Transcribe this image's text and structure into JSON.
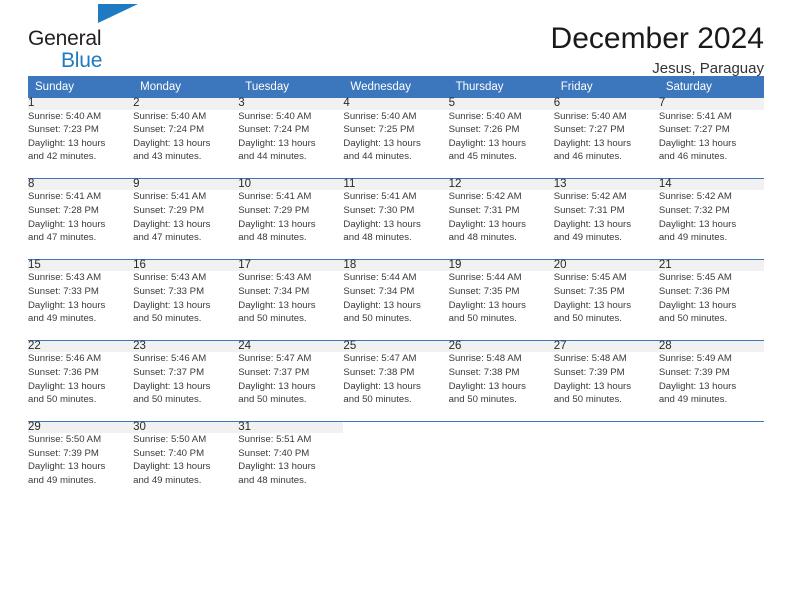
{
  "brand": {
    "name_top": "General",
    "name_bottom": "Blue",
    "flag_icon": "blue-flag-icon",
    "accent_color": "#1f7bc1"
  },
  "header": {
    "title": "December 2024",
    "subtitle": "Jesus, Paraguay"
  },
  "calendar": {
    "header_bg": "#3c77bd",
    "daynum_bg": "#f1f1f1",
    "weekday_headers": [
      "Sunday",
      "Monday",
      "Tuesday",
      "Wednesday",
      "Thursday",
      "Friday",
      "Saturday"
    ],
    "weeks": [
      [
        {
          "day": "1",
          "sunrise": "Sunrise: 5:40 AM",
          "sunset": "Sunset: 7:23 PM",
          "daylight1": "Daylight: 13 hours",
          "daylight2": "and 42 minutes."
        },
        {
          "day": "2",
          "sunrise": "Sunrise: 5:40 AM",
          "sunset": "Sunset: 7:24 PM",
          "daylight1": "Daylight: 13 hours",
          "daylight2": "and 43 minutes."
        },
        {
          "day": "3",
          "sunrise": "Sunrise: 5:40 AM",
          "sunset": "Sunset: 7:24 PM",
          "daylight1": "Daylight: 13 hours",
          "daylight2": "and 44 minutes."
        },
        {
          "day": "4",
          "sunrise": "Sunrise: 5:40 AM",
          "sunset": "Sunset: 7:25 PM",
          "daylight1": "Daylight: 13 hours",
          "daylight2": "and 44 minutes."
        },
        {
          "day": "5",
          "sunrise": "Sunrise: 5:40 AM",
          "sunset": "Sunset: 7:26 PM",
          "daylight1": "Daylight: 13 hours",
          "daylight2": "and 45 minutes."
        },
        {
          "day": "6",
          "sunrise": "Sunrise: 5:40 AM",
          "sunset": "Sunset: 7:27 PM",
          "daylight1": "Daylight: 13 hours",
          "daylight2": "and 46 minutes."
        },
        {
          "day": "7",
          "sunrise": "Sunrise: 5:41 AM",
          "sunset": "Sunset: 7:27 PM",
          "daylight1": "Daylight: 13 hours",
          "daylight2": "and 46 minutes."
        }
      ],
      [
        {
          "day": "8",
          "sunrise": "Sunrise: 5:41 AM",
          "sunset": "Sunset: 7:28 PM",
          "daylight1": "Daylight: 13 hours",
          "daylight2": "and 47 minutes."
        },
        {
          "day": "9",
          "sunrise": "Sunrise: 5:41 AM",
          "sunset": "Sunset: 7:29 PM",
          "daylight1": "Daylight: 13 hours",
          "daylight2": "and 47 minutes."
        },
        {
          "day": "10",
          "sunrise": "Sunrise: 5:41 AM",
          "sunset": "Sunset: 7:29 PM",
          "daylight1": "Daylight: 13 hours",
          "daylight2": "and 48 minutes."
        },
        {
          "day": "11",
          "sunrise": "Sunrise: 5:41 AM",
          "sunset": "Sunset: 7:30 PM",
          "daylight1": "Daylight: 13 hours",
          "daylight2": "and 48 minutes."
        },
        {
          "day": "12",
          "sunrise": "Sunrise: 5:42 AM",
          "sunset": "Sunset: 7:31 PM",
          "daylight1": "Daylight: 13 hours",
          "daylight2": "and 48 minutes."
        },
        {
          "day": "13",
          "sunrise": "Sunrise: 5:42 AM",
          "sunset": "Sunset: 7:31 PM",
          "daylight1": "Daylight: 13 hours",
          "daylight2": "and 49 minutes."
        },
        {
          "day": "14",
          "sunrise": "Sunrise: 5:42 AM",
          "sunset": "Sunset: 7:32 PM",
          "daylight1": "Daylight: 13 hours",
          "daylight2": "and 49 minutes."
        }
      ],
      [
        {
          "day": "15",
          "sunrise": "Sunrise: 5:43 AM",
          "sunset": "Sunset: 7:33 PM",
          "daylight1": "Daylight: 13 hours",
          "daylight2": "and 49 minutes."
        },
        {
          "day": "16",
          "sunrise": "Sunrise: 5:43 AM",
          "sunset": "Sunset: 7:33 PM",
          "daylight1": "Daylight: 13 hours",
          "daylight2": "and 50 minutes."
        },
        {
          "day": "17",
          "sunrise": "Sunrise: 5:43 AM",
          "sunset": "Sunset: 7:34 PM",
          "daylight1": "Daylight: 13 hours",
          "daylight2": "and 50 minutes."
        },
        {
          "day": "18",
          "sunrise": "Sunrise: 5:44 AM",
          "sunset": "Sunset: 7:34 PM",
          "daylight1": "Daylight: 13 hours",
          "daylight2": "and 50 minutes."
        },
        {
          "day": "19",
          "sunrise": "Sunrise: 5:44 AM",
          "sunset": "Sunset: 7:35 PM",
          "daylight1": "Daylight: 13 hours",
          "daylight2": "and 50 minutes."
        },
        {
          "day": "20",
          "sunrise": "Sunrise: 5:45 AM",
          "sunset": "Sunset: 7:35 PM",
          "daylight1": "Daylight: 13 hours",
          "daylight2": "and 50 minutes."
        },
        {
          "day": "21",
          "sunrise": "Sunrise: 5:45 AM",
          "sunset": "Sunset: 7:36 PM",
          "daylight1": "Daylight: 13 hours",
          "daylight2": "and 50 minutes."
        }
      ],
      [
        {
          "day": "22",
          "sunrise": "Sunrise: 5:46 AM",
          "sunset": "Sunset: 7:36 PM",
          "daylight1": "Daylight: 13 hours",
          "daylight2": "and 50 minutes."
        },
        {
          "day": "23",
          "sunrise": "Sunrise: 5:46 AM",
          "sunset": "Sunset: 7:37 PM",
          "daylight1": "Daylight: 13 hours",
          "daylight2": "and 50 minutes."
        },
        {
          "day": "24",
          "sunrise": "Sunrise: 5:47 AM",
          "sunset": "Sunset: 7:37 PM",
          "daylight1": "Daylight: 13 hours",
          "daylight2": "and 50 minutes."
        },
        {
          "day": "25",
          "sunrise": "Sunrise: 5:47 AM",
          "sunset": "Sunset: 7:38 PM",
          "daylight1": "Daylight: 13 hours",
          "daylight2": "and 50 minutes."
        },
        {
          "day": "26",
          "sunrise": "Sunrise: 5:48 AM",
          "sunset": "Sunset: 7:38 PM",
          "daylight1": "Daylight: 13 hours",
          "daylight2": "and 50 minutes."
        },
        {
          "day": "27",
          "sunrise": "Sunrise: 5:48 AM",
          "sunset": "Sunset: 7:39 PM",
          "daylight1": "Daylight: 13 hours",
          "daylight2": "and 50 minutes."
        },
        {
          "day": "28",
          "sunrise": "Sunrise: 5:49 AM",
          "sunset": "Sunset: 7:39 PM",
          "daylight1": "Daylight: 13 hours",
          "daylight2": "and 49 minutes."
        }
      ],
      [
        {
          "day": "29",
          "sunrise": "Sunrise: 5:50 AM",
          "sunset": "Sunset: 7:39 PM",
          "daylight1": "Daylight: 13 hours",
          "daylight2": "and 49 minutes."
        },
        {
          "day": "30",
          "sunrise": "Sunrise: 5:50 AM",
          "sunset": "Sunset: 7:40 PM",
          "daylight1": "Daylight: 13 hours",
          "daylight2": "and 49 minutes."
        },
        {
          "day": "31",
          "sunrise": "Sunrise: 5:51 AM",
          "sunset": "Sunset: 7:40 PM",
          "daylight1": "Daylight: 13 hours",
          "daylight2": "and 48 minutes."
        },
        {
          "day": "",
          "sunrise": "",
          "sunset": "",
          "daylight1": "",
          "daylight2": ""
        },
        {
          "day": "",
          "sunrise": "",
          "sunset": "",
          "daylight1": "",
          "daylight2": ""
        },
        {
          "day": "",
          "sunrise": "",
          "sunset": "",
          "daylight1": "",
          "daylight2": ""
        },
        {
          "day": "",
          "sunrise": "",
          "sunset": "",
          "daylight1": "",
          "daylight2": ""
        }
      ]
    ]
  }
}
